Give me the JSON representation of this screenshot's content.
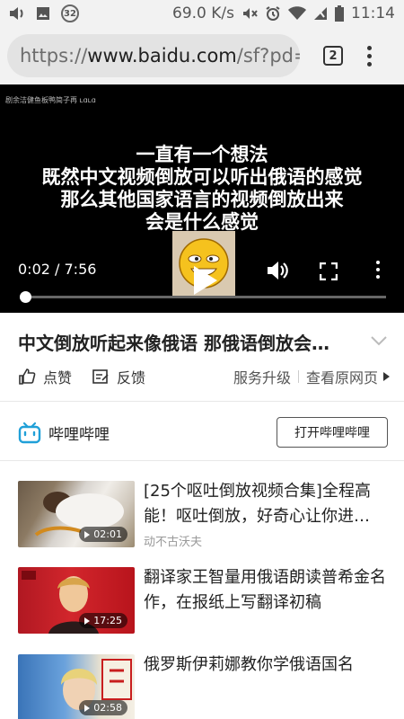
{
  "status_bar": {
    "notification_badge": "32",
    "network_speed": "69.0 K/s",
    "time": "11:14",
    "icons": [
      "volume-icon",
      "image-icon",
      "mute-icon",
      "alarm-icon",
      "wifi-icon",
      "signal-icon",
      "battery-icon"
    ]
  },
  "browser": {
    "url_prefix": "https://",
    "url_domain": "www.baidu.com",
    "url_path": "/sf?pd=",
    "tab_count": "2"
  },
  "video": {
    "watermark": "剧余洁健鱼板鸭简子再 ʟɑʟɑ",
    "caption_lines": [
      "一直有一个想法",
      "既然中文视频倒放可以听出俄语的感觉",
      "那么其他国家语言的视频倒放出来",
      "会是什么感觉"
    ],
    "current_time": "0:02",
    "duration": "7:56",
    "time_display": "0:02 / 7:56",
    "progress_fraction": 0.004
  },
  "page": {
    "title": "中文倒放听起来像俄语 那俄语倒放会…",
    "actions": {
      "like": "点赞",
      "feedback": "反馈",
      "service_upgrade": "服务升级",
      "view_original": "查看原网页"
    },
    "source": {
      "name": "哔哩哔哩",
      "open_button": "打开哔哩哔哩",
      "brand_color": "#20a0d8"
    }
  },
  "related": [
    {
      "title": "[25个呕吐倒放视频合集]全程高能！呕吐倒放，好奇心让你进…",
      "author": "动不古沃夫",
      "duration": "02:01"
    },
    {
      "title": "翻译家王智量用俄语朗读普希金名作，在报纸上写翻译初稿",
      "author": "",
      "duration": "17:25"
    },
    {
      "title": "俄罗斯伊莉娜教你学俄语国名",
      "author": "",
      "duration": "02:58"
    }
  ]
}
